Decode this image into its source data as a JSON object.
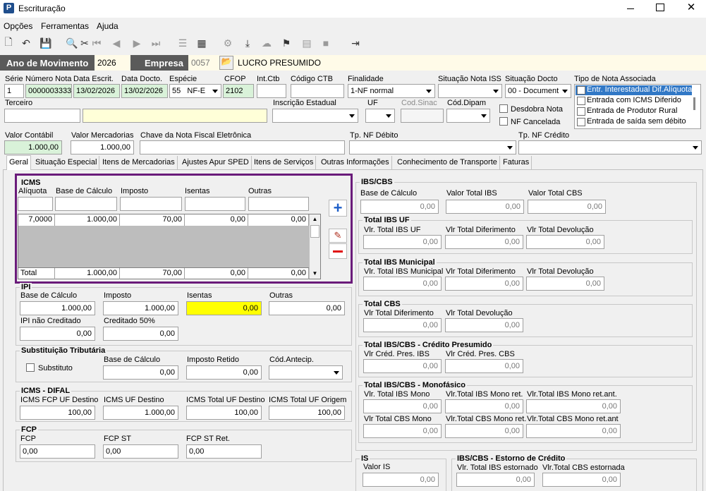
{
  "window": {
    "title": "Escrituração",
    "app_icon": "P"
  },
  "menu": [
    "Opções",
    "Ferramentas",
    "Ajuda"
  ],
  "header": {
    "ano_label": "Ano de Movimento",
    "ano_value": "2026",
    "empresa_label": "Empresa",
    "empresa_code": "0057",
    "empresa_name": "LUCRO PRESUMIDO"
  },
  "fields": {
    "serie_label": "Série",
    "serie": "1",
    "numero_label": "Número Nota",
    "numero": "0000003333",
    "data_escrit_label": "Data Escrit.",
    "data_escrit": "13/02/2026",
    "data_docto_label": "Data Docto.",
    "data_docto": "13/02/2026",
    "especie_label": "Espécie",
    "especie_code": "55",
    "especie": "NF-E",
    "cfop_label": "CFOP",
    "cfop": "2102",
    "intctb_label": "Int.Ctb",
    "codctb_label": "Código CTB",
    "finalidade_label": "Finalidade",
    "finalidade": "1-NF normal",
    "sit_iss_label": "Situação Nota ISS",
    "sit_docto_label": "Situação Docto",
    "sit_docto": "00 - Document",
    "tipo_nota_label": "Tipo de Nota Associada",
    "tipo_nota_items": [
      "Entr. Interestadual Dif.Alíquota",
      "Entrada com ICMS Diferido",
      "Entrada de Produtor Rural",
      "Entrada de saída sem débito"
    ],
    "terceiro_label": "Terceiro",
    "ie_label": "Inscrição Estadual",
    "uf_label": "UF",
    "codsinac_label": "Cod.Sinac",
    "coddipam_label": "Cód.Dipam",
    "desdobra_label": "Desdobra Nota",
    "cancelada_label": "NF Cancelada",
    "valor_contabil_label": "Valor Contábil",
    "valor_contabil": "1.000,00",
    "valor_merc_label": "Valor Mercadorias",
    "valor_merc": "1.000,00",
    "chave_label": "Chave da Nota Fiscal Eletrônica",
    "tp_debito_label": "Tp. NF Débito",
    "tp_credito_label": "Tp. NF Crédito"
  },
  "tabs": [
    "Geral",
    "Situação Especial",
    "Itens de Mercadorias",
    "Ajustes Apur SPED",
    "Itens de Serviços",
    "Outras Informações",
    "Conhecimento de Transporte",
    "Faturas"
  ],
  "icms": {
    "title": "ICMS",
    "headers": [
      "Alíquota",
      "Base de Cálculo",
      "Imposto",
      "Isentas",
      "Outras"
    ],
    "row": [
      "7,0000",
      "1.000,00",
      "70,00",
      "0,00",
      "0,00"
    ],
    "total_label": "Total",
    "total": [
      "1.000,00",
      "70,00",
      "0,00",
      "0,00"
    ]
  },
  "ipi": {
    "title": "IPI",
    "base_label": "Base de Cálculo",
    "base": "1.000,00",
    "imposto_label": "Imposto",
    "imposto": "1.000,00",
    "isentas_label": "Isentas",
    "isentas": "0,00",
    "outras_label": "Outras",
    "outras": "0,00",
    "nao_cred_label": "IPI não Creditado",
    "nao_cred": "0,00",
    "cred50_label": "Creditado 50%",
    "cred50": "0,00"
  },
  "st": {
    "title": "Substituição Tributária",
    "substituto_label": "Substituto",
    "base_label": "Base de Cálculo",
    "base": "0,00",
    "retido_label": "Imposto Retido",
    "retido": "0,00",
    "antecip_label": "Cód.Antecip."
  },
  "difal": {
    "title": "ICMS - DIFAL",
    "fcp_label": "ICMS FCP UF Destino",
    "fcp": "100,00",
    "uf_dest_label": "ICMS UF Destino",
    "uf_dest": "1.000,00",
    "total_dest_label": "ICMS Total UF Destino",
    "total_dest": "100,00",
    "total_orig_label": "ICMS Total UF Origem",
    "total_orig": "100,00"
  },
  "fcp": {
    "title": "FCP",
    "fcp_label": "FCP",
    "fcp": "0,00",
    "fcpst_label": "FCP ST",
    "fcpst": "0,00",
    "fcpstret_label": "FCP ST Ret.",
    "fcpstret": "0,00"
  },
  "ibscbs": {
    "title": "IBS/CBS",
    "base_label": "Base de Cálculo",
    "base": "0,00",
    "ibs_label": "Valor Total IBS",
    "ibs": "0,00",
    "cbs_label": "Valor Total CBS",
    "cbs": "0,00",
    "uf_title": "Total IBS UF",
    "uf_l1": "Vlr. Total IBS UF",
    "uf_v1": "0,00",
    "uf_l2": "Vlr Total Diferimento",
    "uf_v2": "0,00",
    "uf_l3": "Vlr Total Devolução",
    "uf_v3": "0,00",
    "mun_title": "Total IBS Municipal",
    "mun_l1": "Vlr. Total IBS Municipal",
    "mun_v1": "0,00",
    "mun_l2": "Vlr Total Diferimento",
    "mun_v2": "0,00",
    "mun_l3": "Vlr Total Devolução",
    "mun_v3": "0,00",
    "cbs_title": "Total CBS",
    "cbs_l1": "Vlr Total Diferimento",
    "cbs_v1": "0,00",
    "cbs_l2": "Vlr Total Devolução",
    "cbs_v2": "0,00",
    "pres_title": "Total IBS/CBS - Crédito Presumido",
    "pres_l1": "Vlr Créd. Pres. IBS",
    "pres_v1": "0,00",
    "pres_l2": "Vlr Créd. Pres. CBS",
    "pres_v2": "0,00",
    "mono_title": "Total IBS/CBS - Monofásico",
    "mono_l1": "Vlr. Total IBS Mono",
    "mono_v1": "0,00",
    "mono_l2": "Vlr.Total IBS Mono ret.",
    "mono_v2": "0,00",
    "mono_l3": "Vlr.Total IBS Mono ret.ant.",
    "mono_v3": "0,00",
    "mono_l4": "Vlr Total CBS Mono",
    "mono_v4": "0,00",
    "mono_l5": "Vlr.Total CBS Mono ret.",
    "mono_v5": "0,00",
    "mono_l6": "Vlr.Total CBS Mono ret.ant",
    "mono_v6": "0,00"
  },
  "is": {
    "title": "IS",
    "valor_label": "Valor IS",
    "valor": "0,00"
  },
  "estorno": {
    "title": "IBS/CBS - Estorno de Crédito",
    "l1": "Vlr. Total IBS estornado",
    "v1": "0,00",
    "l2": "Vlr.Total CBS estornada",
    "v2": "0,00"
  },
  "colors": {
    "header_dark": "#5a5a5a",
    "highlight_purple": "#6a1b7a",
    "selection_blue": "#3178c6",
    "yellow_field": "#ffff00"
  }
}
